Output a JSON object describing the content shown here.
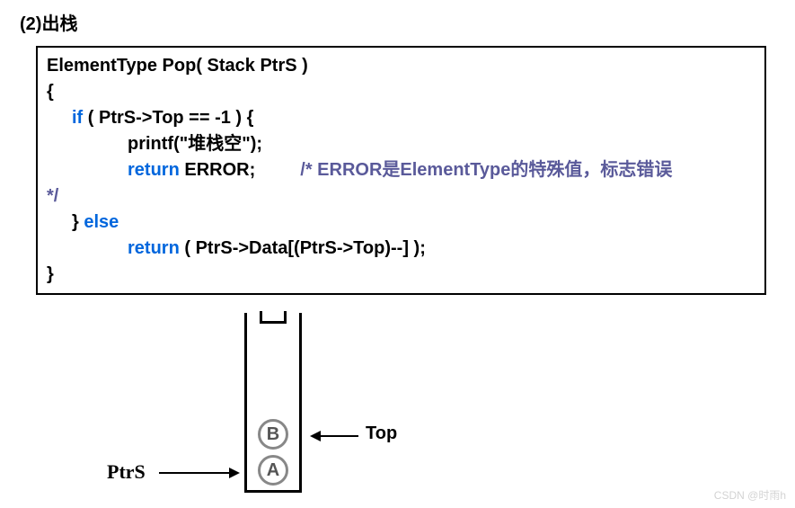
{
  "heading": "(2)出栈",
  "code": {
    "sig": "ElementType Pop( Stack PtrS )",
    "open": "{",
    "if_kw": "if",
    "if_cond": " ( PtrS->Top == -1 ) {",
    "printf": "printf(\"堆栈空\");",
    "return_kw": "return",
    "return_err": " ERROR;",
    "comment_open": "/* ERROR是ElementType的特殊值，标志错误",
    "comment_close": "*/",
    "close_else": "} ",
    "else_kw": "else",
    "return2_kw": "return",
    "return2_expr": " ( PtrS->Data[(PtrS->Top)--] );",
    "close": "}"
  },
  "diagram": {
    "cell_b": "B",
    "cell_a": "A",
    "top_label": "Top",
    "ptrs_label": "PtrS"
  },
  "watermark": "CSDN @时雨h"
}
